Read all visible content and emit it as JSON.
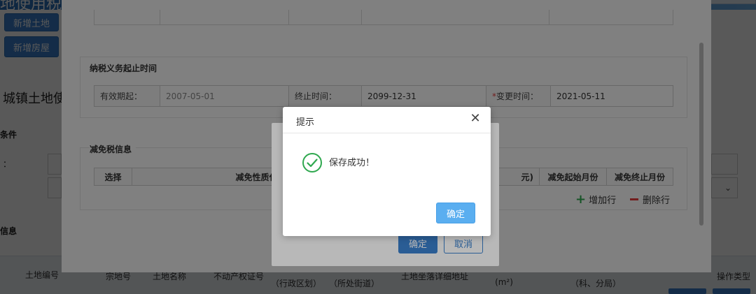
{
  "page": {
    "header_title": "地使用税协) 税税源信息采集",
    "left_buttons": [
      "新增土地",
      "新增房屋"
    ],
    "section_title": "城镇土地使",
    "condition_label": "条件",
    "colon": "：",
    "info_label": "信息",
    "table_headers": [
      "土地编号",
      "宗地号",
      "土地名称",
      "不动产权证号",
      "（行政区划）",
      "（所处街道）",
      "土地坐落详细地址",
      "(m²)",
      "（科、分局）",
      "操作类型"
    ]
  },
  "panel": {
    "duty_period": {
      "title": "纳税义务起止时间",
      "start_label": "有效期起：",
      "start_value": "2007-05-01",
      "end_label": "终止时间：",
      "end_value": "2099-12-31",
      "req_mark": "*",
      "change_label": "变更时间：",
      "change_value": "2021-05-11"
    },
    "relief": {
      "title": "减免税信息",
      "col_select": "选择",
      "col_nature": "减免性质代码",
      "col_partial": "元)",
      "col_start": "减免起始月份",
      "col_end": "减免终止月份",
      "add_row": "增加行",
      "del_row": "删除行"
    }
  },
  "mid_dialog": {
    "confirm": "确定",
    "cancel": "取消"
  },
  "alert": {
    "title": "提示",
    "message": "保存成功！",
    "ok": "确定"
  },
  "colors": {
    "primary": "#3b82cf",
    "success": "#2fa84f",
    "danger": "#e23b3b",
    "ok_button": "#5aaef0"
  },
  "icons": {
    "close": "close-icon",
    "success": "check-circle-icon",
    "plus": "plus-icon",
    "minus": "minus-icon",
    "select": "chevron-down-icon"
  }
}
